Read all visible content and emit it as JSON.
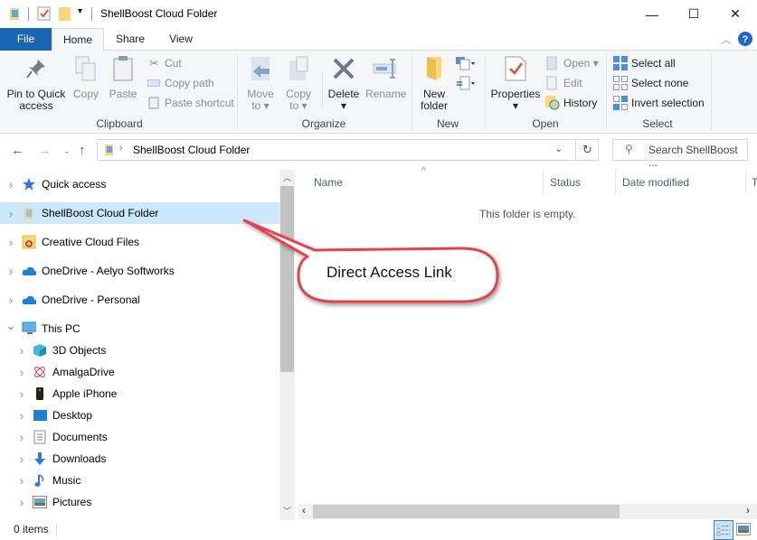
{
  "window": {
    "title": "ShellBoost Cloud Folder",
    "controls": {
      "minimize": "—",
      "maximize": "☐",
      "close": "✕"
    }
  },
  "ribbon_tabs": [
    "File",
    "Home",
    "Share",
    "View"
  ],
  "ribbon": {
    "clipboard": {
      "label": "Clipboard",
      "pin": "Pin to Quick access",
      "pin_line1": "Pin to Quick",
      "pin_line2": "access",
      "copy": "Copy",
      "paste": "Paste",
      "cut": "Cut",
      "copy_path": "Copy path",
      "paste_shortcut": "Paste shortcut"
    },
    "organize": {
      "label": "Organize",
      "move_to_1": "Move",
      "move_to_2": "to",
      "copy_to_1": "Copy",
      "copy_to_2": "to",
      "delete": "Delete",
      "rename": "Rename"
    },
    "new": {
      "label": "New",
      "new_folder_1": "New",
      "new_folder_2": "folder"
    },
    "open": {
      "label": "Open",
      "properties": "Properties",
      "open": "Open",
      "edit": "Edit",
      "history": "History"
    },
    "select": {
      "label": "Select",
      "select_all": "Select all",
      "select_none": "Select none",
      "invert": "Invert selection"
    }
  },
  "address": {
    "path": "ShellBoost Cloud Folder",
    "search_placeholder": "Search ShellBoost ..."
  },
  "nav_tree": [
    {
      "label": "Quick access",
      "icon": "star-icon",
      "level": 0,
      "expanded": false
    },
    {
      "label": "ShellBoost Cloud Folder",
      "icon": "cloud-folder-icon",
      "level": 0,
      "expanded": false,
      "selected": true
    },
    {
      "label": "Creative Cloud Files",
      "icon": "creative-cloud-icon",
      "level": 0,
      "expanded": false
    },
    {
      "label": "OneDrive - Aelyo Softworks",
      "icon": "onedrive-icon",
      "level": 0,
      "expanded": false
    },
    {
      "label": "OneDrive - Personal",
      "icon": "onedrive-icon",
      "level": 0,
      "expanded": false
    },
    {
      "label": "This PC",
      "icon": "computer-icon",
      "level": 0,
      "expanded": true
    },
    {
      "label": "3D Objects",
      "icon": "cube-icon",
      "level": 1
    },
    {
      "label": "AmalgaDrive",
      "icon": "amalgadrive-icon",
      "level": 1
    },
    {
      "label": "Apple iPhone",
      "icon": "phone-icon",
      "level": 1
    },
    {
      "label": "Desktop",
      "icon": "desktop-icon",
      "level": 1
    },
    {
      "label": "Documents",
      "icon": "documents-icon",
      "level": 1
    },
    {
      "label": "Downloads",
      "icon": "download-icon",
      "level": 1
    },
    {
      "label": "Music",
      "icon": "music-icon",
      "level": 1
    },
    {
      "label": "Pictures",
      "icon": "pictures-icon",
      "level": 1
    }
  ],
  "columns": [
    "Name",
    "Status",
    "Date modified",
    "T"
  ],
  "empty_message": "This folder is empty.",
  "status": {
    "item_count": "0 items"
  },
  "callout": {
    "text": "Direct Access Link",
    "color": "#e8414a"
  },
  "colors": {
    "accent": "#1a66b3",
    "selection": "#cce8ff"
  }
}
